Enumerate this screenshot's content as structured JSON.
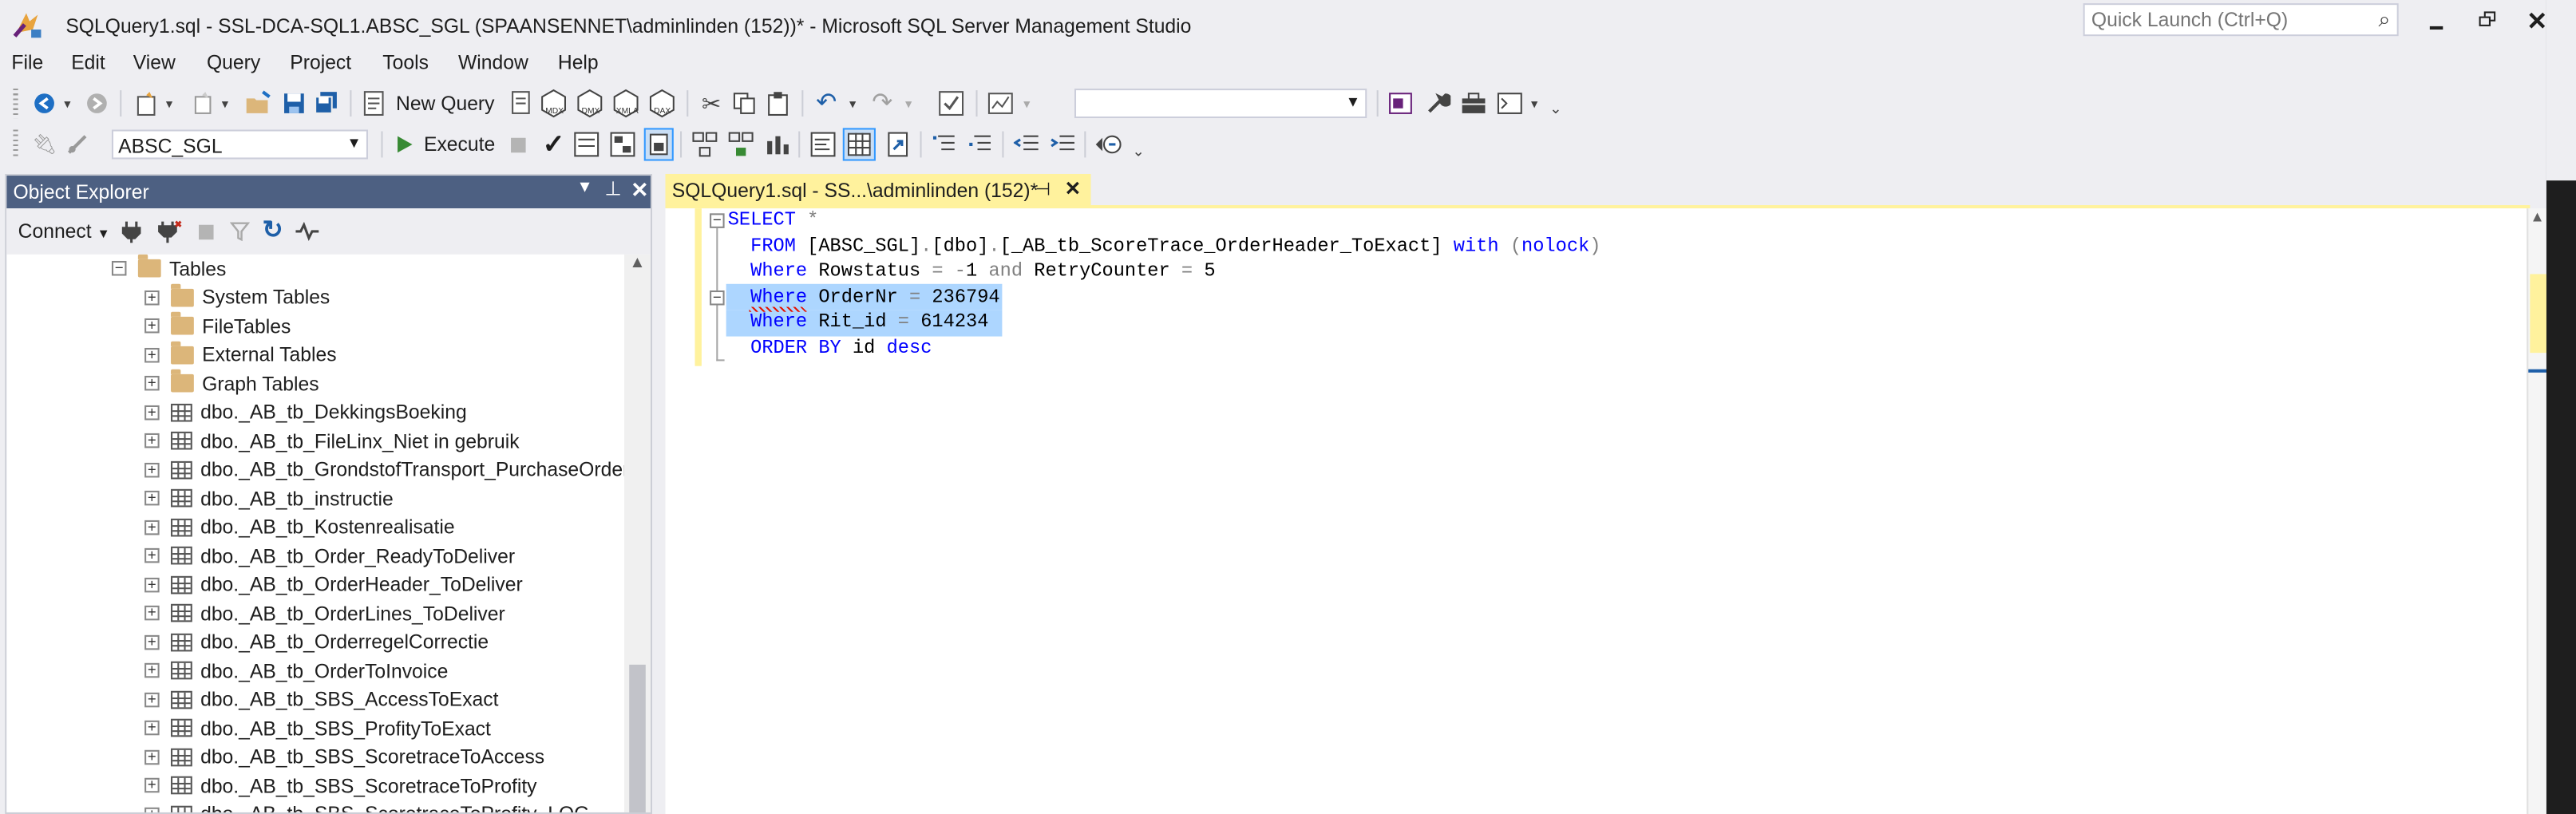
{
  "window": {
    "title": "SQLQuery1.sql - SSL-DCA-SQL1.ABSC_SGL (SPAANSENNET\\adminlinden (152))* - Microsoft SQL Server Management Studio",
    "quick_launch_placeholder": "Quick Launch (Ctrl+Q)"
  },
  "menu": [
    "File",
    "Edit",
    "View",
    "Query",
    "Project",
    "Tools",
    "Window",
    "Help"
  ],
  "toolbar": {
    "new_query_label": "New Query",
    "database_value": "ABSC_SGL",
    "execute_label": "Execute",
    "mini_icons": [
      "MDX",
      "DMX",
      "XMLA",
      "DAX"
    ]
  },
  "object_explorer": {
    "title": "Object Explorer",
    "connect_label": "Connect",
    "tree": [
      {
        "label": "Tables",
        "type": "folder",
        "expanded": true
      },
      {
        "label": "System Tables",
        "type": "folder"
      },
      {
        "label": "FileTables",
        "type": "folder"
      },
      {
        "label": "External Tables",
        "type": "folder"
      },
      {
        "label": "Graph Tables",
        "type": "folder"
      },
      {
        "label": "dbo._AB_tb_DekkingsBoeking",
        "type": "table"
      },
      {
        "label": "dbo._AB_tb_FileLinx_Niet in gebruik",
        "type": "table"
      },
      {
        "label": "dbo._AB_tb_GrondstofTransport_PurchaseOrders",
        "type": "table"
      },
      {
        "label": "dbo._AB_tb_instructie",
        "type": "table"
      },
      {
        "label": "dbo._AB_tb_Kostenrealisatie",
        "type": "table"
      },
      {
        "label": "dbo._AB_tb_Order_ReadyToDeliver",
        "type": "table"
      },
      {
        "label": "dbo._AB_tb_OrderHeader_ToDeliver",
        "type": "table"
      },
      {
        "label": "dbo._AB_tb_OrderLines_ToDeliver",
        "type": "table"
      },
      {
        "label": "dbo._AB_tb_OrderregelCorrectie",
        "type": "table"
      },
      {
        "label": "dbo._AB_tb_OrderToInvoice",
        "type": "table"
      },
      {
        "label": "dbo._AB_tb_SBS_AccessToExact",
        "type": "table"
      },
      {
        "label": "dbo._AB_tb_SBS_ProfityToExact",
        "type": "table"
      },
      {
        "label": "dbo._AB_tb_SBS_ScoretraceToAccess",
        "type": "table"
      },
      {
        "label": "dbo._AB_tb_SBS_ScoretraceToProfity",
        "type": "table"
      },
      {
        "label": "dbo._AB_tb_SBS_ScoretraceToProfity_LOG",
        "type": "table"
      }
    ]
  },
  "editor": {
    "tab_label": "SQLQuery1.sql - SS...\\adminlinden (152)*",
    "lines": [
      [
        {
          "t": "SELECT",
          "c": "kw"
        },
        {
          "t": " ",
          "c": "tx"
        },
        {
          "t": "*",
          "c": "gy"
        }
      ],
      [
        {
          "t": "  FROM ",
          "c": "kw"
        },
        {
          "t": "[ABSC_SGL]",
          "c": "tx"
        },
        {
          "t": ".",
          "c": "gy"
        },
        {
          "t": "[dbo]",
          "c": "tx"
        },
        {
          "t": ".",
          "c": "gy"
        },
        {
          "t": "[_AB_tb_ScoreTrace_OrderHeader_ToExact]",
          "c": "tx"
        },
        {
          "t": " with ",
          "c": "kw"
        },
        {
          "t": "(",
          "c": "gy"
        },
        {
          "t": "nolock",
          "c": "kw"
        },
        {
          "t": ")",
          "c": "gy"
        }
      ],
      [
        {
          "t": "  Where ",
          "c": "kw"
        },
        {
          "t": "Rowstatus ",
          "c": "tx"
        },
        {
          "t": "= -",
          "c": "gy"
        },
        {
          "t": "1 ",
          "c": "tx"
        },
        {
          "t": "and ",
          "c": "gy"
        },
        {
          "t": "RetryCounter ",
          "c": "tx"
        },
        {
          "t": "= ",
          "c": "gy"
        },
        {
          "t": "5",
          "c": "tx"
        }
      ],
      [
        {
          "t": "  Where ",
          "c": "kw"
        },
        {
          "t": "OrderNr ",
          "c": "tx"
        },
        {
          "t": "= ",
          "c": "gy"
        },
        {
          "t": "236794",
          "c": "tx"
        }
      ],
      [
        {
          "t": "  Where ",
          "c": "kw"
        },
        {
          "t": "Rit_id ",
          "c": "tx"
        },
        {
          "t": "= ",
          "c": "gy"
        },
        {
          "t": "614234",
          "c": "tx"
        }
      ],
      [
        {
          "t": "  ORDER BY ",
          "c": "kw"
        },
        {
          "t": "id ",
          "c": "tx"
        },
        {
          "t": "desc",
          "c": "kw"
        }
      ]
    ]
  },
  "colors": {
    "accent": "#007acc",
    "tab_active": "#fff29d",
    "panel_header": "#4d6082",
    "folder": "#dcb67a",
    "selection": "#add6ff"
  }
}
